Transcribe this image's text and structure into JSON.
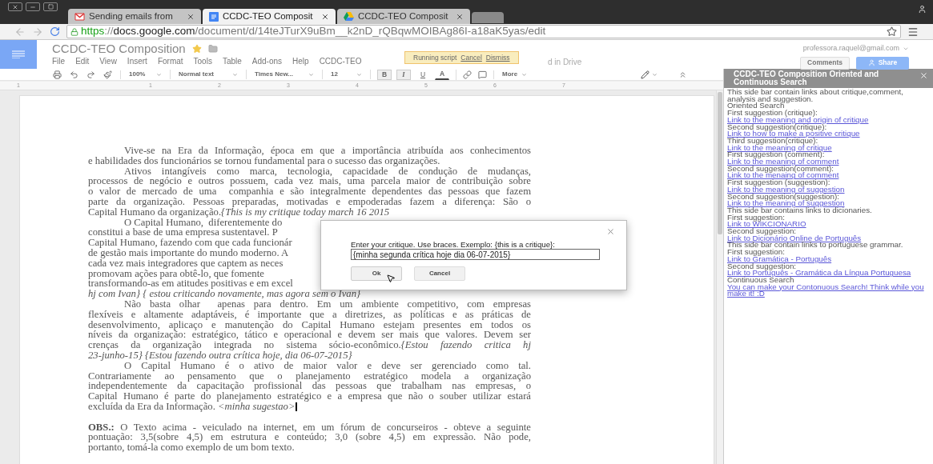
{
  "browser": {
    "tabs": [
      {
        "title": "Sending emails from",
        "selected": false
      },
      {
        "title": "CCDC-TEO Composit",
        "selected": true
      },
      {
        "title": "CCDC-TEO Composit",
        "selected": false
      }
    ],
    "url": {
      "scheme": "https",
      "separator": "://",
      "host": "docs.google.com",
      "path": "/document/d/14teJTurX9uBm__k2nD_rQBqwMOIBAg86I-a18aK5yas/edit"
    }
  },
  "doc": {
    "title": "CCDC-TEO Composition",
    "starred": true,
    "menu": [
      "File",
      "Edit",
      "View",
      "Insert",
      "Format",
      "Tools",
      "Table",
      "Add-ons",
      "Help",
      "CCDC-TEO"
    ],
    "save_status": "d in Drive",
    "toast": {
      "text": "Running script",
      "actions": [
        "Cancel",
        "Dismiss"
      ]
    },
    "account": "professora.raquel@gmail.com",
    "comments_button": "Comments",
    "share_button": "Share"
  },
  "toolbar": {
    "zoom": "100%",
    "style": "Normal text",
    "font": "Times New...",
    "size": "12",
    "format": [
      {
        "label": "B",
        "selected": true
      },
      {
        "label": "I",
        "selected": true
      },
      {
        "label": "U",
        "selected": false
      },
      {
        "label": "A",
        "selected": false
      }
    ],
    "more": "More"
  },
  "ruler": [
    "1",
    "1",
    "2",
    "3",
    "4",
    "5",
    "6",
    "7"
  ],
  "paragraphs": [
    {
      "indented": true,
      "lines": [
        {
          "text": "Vive-se na Era da Informação, época em que a importância atribuída aos conhecimentos",
          "kind": "justified"
        },
        {
          "text": "e habilidades dos funcionários se tornou fundamental para o sucesso das organizações.",
          "kind": "ragged"
        }
      ]
    },
    {
      "indented": true,
      "lines": [
        {
          "text": "Ativos intangíveis como marca, tecnologia, capacidade de condução de mudanças,",
          "kind": "justified"
        },
        {
          "text": "processos de negócio e outros possuem, cada vez mais, uma parcela maior de contribuição sobre",
          "kind": "justified"
        },
        {
          "text": "o valor de mercado de uma  companhia e são integralmente dependentes das pessoas que fazem",
          "kind": "justified"
        },
        {
          "text": "parte da organização. Pessoas preparadas, motivadas e empoderadas fazem a diferença: São o",
          "kind": "justified"
        },
        {
          "text": "Capital Humano da organização.*{This is my critique today march 16 2015*",
          "kind": "ragged"
        }
      ]
    },
    {
      "indented": true,
      "lines": [
        {
          "text": "O Capital Humano,  diferentemente do",
          "kind": "cut"
        },
        {
          "text": "constitui a base de uma empresa sustentavel. P",
          "kind": "cut"
        },
        {
          "text": "Capital Humano, fazendo com que cada funcionár",
          "kind": "cut"
        },
        {
          "text": "de gestão mais importante do mundo moderno. A",
          "kind": "cut"
        },
        {
          "text": "cada vez mais integradores que captem as neces",
          "kind": "cut"
        },
        {
          "text": "promovam ações para obtê-lo, que fomente",
          "kind": "cut"
        },
        {
          "text": "transformando-as em atitudes positivas e em excel",
          "kind": "cut"
        },
        {
          "text": "*hj com Ivan} { estou criticando novamente, mas agora sem o Ivan}*",
          "kind": "ragged"
        }
      ]
    },
    {
      "indented": true,
      "lines": [
        {
          "text": "Não basta olhar  apenas para dentro. Em um ambiente competitivo, com empresas",
          "kind": "justified"
        },
        {
          "text": "flexíveis e altamente adaptáveis, é importante que a diretrizes, as políticas e as práticas de",
          "kind": "justified"
        },
        {
          "text": "desenvolvimento, aplicaço e manutenção do Capital Humano estejam presentes em todos os",
          "kind": "justified"
        },
        {
          "text": "níveis da organização: estratégico, tático e operacional e devem ser mais que valores. Devem ser",
          "kind": "justified"
        },
        {
          "text": "crenças da organização integrada no sistema sócio-econômico.*{Estou fazendo critica hj*",
          "kind": "justified"
        },
        {
          "text": "*23-junho-15} {Estou fazendo outra crítica hoje, dia 06-07-2015}*",
          "kind": "ragged"
        }
      ]
    },
    {
      "indented": true,
      "lines": [
        {
          "text": "O Capital Humano é o ativo de maior valor e deve ser gerenciado como tal.",
          "kind": "justified"
        },
        {
          "text": "Contrariamente ao pensamento que o planejamento estratégico modela a organização",
          "kind": "justified"
        },
        {
          "text": "independentemente da capacitação profissional das pessoas que trabalham nas empresas, o",
          "kind": "justified"
        },
        {
          "text": "Capital Humano é parte do planejamento estratégico e a empresa que não o souber utilizar estará",
          "kind": "justified"
        },
        {
          "text": "excluída da Era da Informação. *<minha sugestao>*",
          "kind": "ragged"
        }
      ]
    },
    {
      "indented": false,
      "lines": [
        {
          "text": "**OBS.:** O Texto acima - veiculado na internet, em um fórum de concurseiros - obteve a seguinte",
          "kind": "justified"
        },
        {
          "text": "pontuação: 3,5(sobre 4,5) em estrutura e conteúdo; 3,0 (sobre 4,5) em expressão. Não pode,",
          "kind": "justified"
        },
        {
          "text": "portanto, tomá-la como exemplo de um bom texto.",
          "kind": "ragged"
        }
      ]
    }
  ],
  "dialog": {
    "label": "Enter your critique. Use braces. Exemplo: {this is a critique}:",
    "value": "{minha segunda crítica hoje dia 06-07-2015}",
    "ok": "Ok",
    "cancel": "Cancel"
  },
  "sidebar": {
    "title": "CCDC-TEO Composition Oriented and Continuous Search",
    "items": [
      {
        "kind": "text",
        "text": "This side bar contain links about critique,comment, analysis and suggestion."
      },
      {
        "kind": "text",
        "text": "Oriented Search"
      },
      {
        "kind": "text",
        "text": "First suggestion (critique):"
      },
      {
        "kind": "link",
        "text": "Link to the meaning and origin of critique"
      },
      {
        "kind": "text",
        "text": "Second suggestion(critique):"
      },
      {
        "kind": "link",
        "text": "Link to how to make a positive critique"
      },
      {
        "kind": "text",
        "text": "Third suggestion(critique):"
      },
      {
        "kind": "link",
        "text": "Link to the meaning of critique"
      },
      {
        "kind": "text",
        "text": "First suggestion (comment):"
      },
      {
        "kind": "link",
        "text": "Link to the meaning of comment"
      },
      {
        "kind": "text",
        "text": "Second suggestion(comment):"
      },
      {
        "kind": "link",
        "text": "Link to the menaing of comment"
      },
      {
        "kind": "text",
        "text": "First suggestion (suggestion):"
      },
      {
        "kind": "link",
        "text": "Link to the meaning of suggestion"
      },
      {
        "kind": "text",
        "text": "Second suggestion(suggestion):"
      },
      {
        "kind": "link",
        "text": "Link to the meaning of suggestion"
      },
      {
        "kind": "text",
        "text": "This side bar contains links to dicionaries."
      },
      {
        "kind": "text",
        "text": "First suggestion:"
      },
      {
        "kind": "link",
        "text": "Link to WIKCIONARIO"
      },
      {
        "kind": "text",
        "text": "Second suggestion:"
      },
      {
        "kind": "link",
        "text": "Link to Dicionário Online de Português"
      },
      {
        "kind": "text",
        "text": "This side bar contain links to portuguese grammar."
      },
      {
        "kind": "text",
        "text": "First suggestion:"
      },
      {
        "kind": "link",
        "text": "Link to Gramática - Português"
      },
      {
        "kind": "text",
        "text": "Second suggestion:"
      },
      {
        "kind": "link",
        "text": "Link to Português - Gramática da Língua Portuguesa"
      },
      {
        "kind": "text",
        "text": "Continuous Search"
      },
      {
        "kind": "link",
        "text": "You can make your Contonuous Search! Think while you make it! :D"
      }
    ]
  }
}
